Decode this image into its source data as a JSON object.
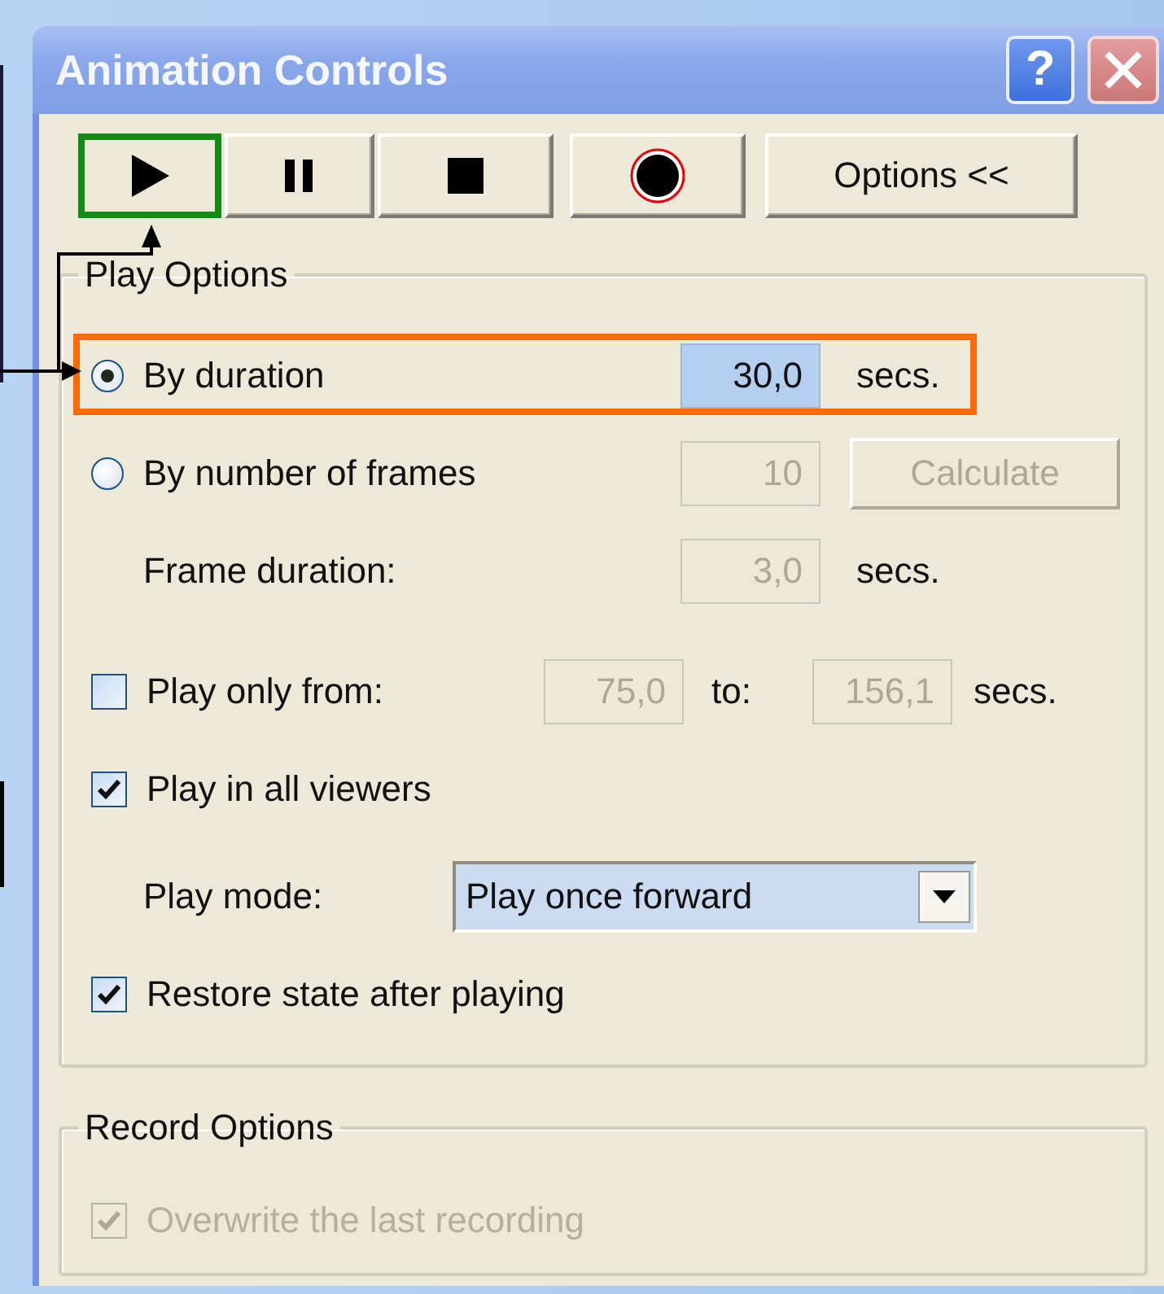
{
  "window": {
    "title": "Animation Controls",
    "help_button": "?"
  },
  "toolbar": [
    {
      "kind": "play",
      "highlighted": true
    },
    {
      "kind": "pause",
      "highlighted": false
    },
    {
      "kind": "stop",
      "highlighted": false
    },
    {
      "kind": "record",
      "highlighted": false
    },
    {
      "kind": "text",
      "label": "Options <<",
      "highlighted": false
    }
  ],
  "play_options": {
    "title": "Play Options",
    "rows": [
      {
        "kind": "radio",
        "label": "By duration",
        "selected": true,
        "highlighted": true,
        "field": {
          "value": "30,0",
          "disabled": false,
          "selected": true
        },
        "unit": "secs."
      },
      {
        "kind": "radio",
        "label": "By number of frames",
        "selected": false,
        "highlighted": false,
        "field": {
          "value": "10",
          "disabled": true,
          "selected": false
        },
        "button": {
          "label": "Calculate",
          "disabled": true
        }
      },
      {
        "kind": "field",
        "label": "Frame duration:",
        "field": {
          "value": "3,0",
          "disabled": true,
          "selected": false
        },
        "unit": "secs."
      },
      {
        "kind": "range",
        "label": "Play only from:",
        "checked": false,
        "disabled": false,
        "from": {
          "value": "75,0",
          "disabled": true,
          "selected": false
        },
        "to_label": "to:",
        "to": {
          "value": "156,1",
          "disabled": true,
          "selected": false
        },
        "unit": "secs."
      },
      {
        "kind": "checkbox",
        "label": "Play in all viewers",
        "checked": true,
        "disabled": false
      },
      {
        "kind": "dropdown",
        "label": "Play mode:",
        "value": "Play once forward"
      },
      {
        "kind": "checkbox",
        "label": "Restore state after playing",
        "checked": true,
        "disabled": false
      }
    ]
  },
  "record_options": {
    "title": "Record Options",
    "rows": [
      {
        "kind": "checkbox",
        "label": "Overwrite the last recording",
        "checked": true,
        "disabled": true
      }
    ]
  }
}
